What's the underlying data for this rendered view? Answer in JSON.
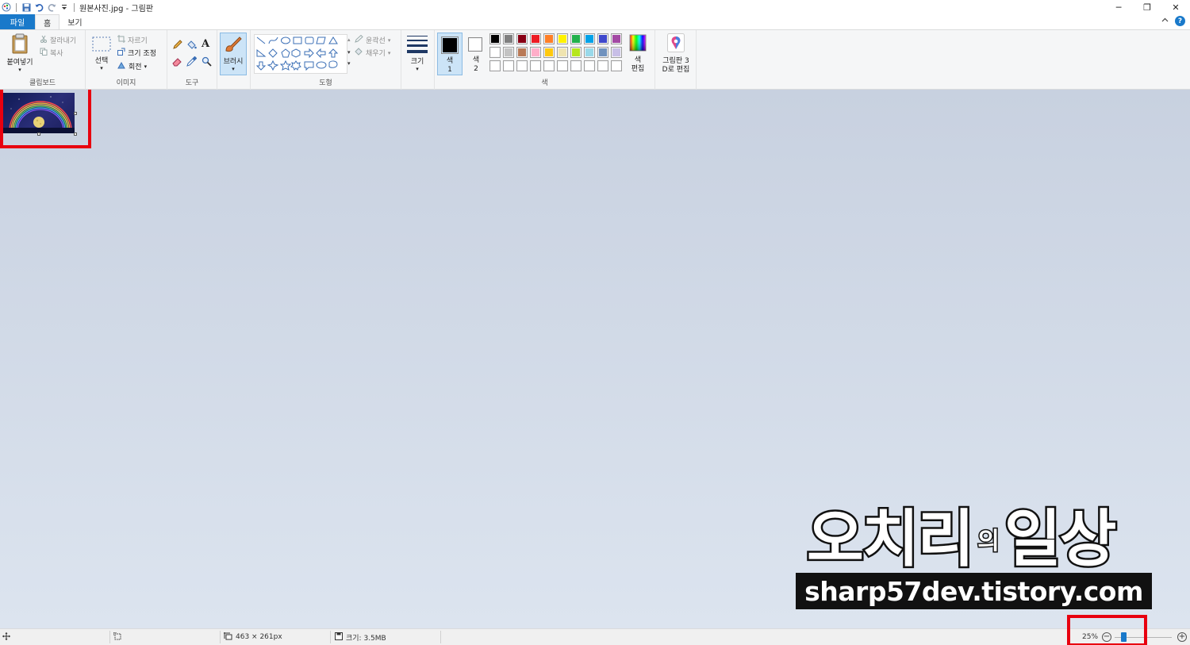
{
  "window": {
    "title": "원본사진.jpg - 그림판",
    "controls": {
      "minimize": "─",
      "restore": "❐",
      "close": "✕"
    }
  },
  "tabs": [
    {
      "label": "파일"
    },
    {
      "label": "홈"
    },
    {
      "label": "보기"
    }
  ],
  "help_label": "?",
  "ribbon": {
    "clipboard": {
      "label": "클립보드",
      "paste": "붙여넣기",
      "cut": "잘라내기",
      "copy": "복사"
    },
    "image": {
      "label": "이미지",
      "select": "선택",
      "crop": "자르기",
      "resize": "크기 조정",
      "rotate": "회전"
    },
    "tools": {
      "label": "도구",
      "text_tool": "A"
    },
    "brushes": {
      "label": "브러시"
    },
    "shapes": {
      "label": "도형",
      "outline": "윤곽선",
      "fill": "채우기"
    },
    "size": {
      "label": "크기"
    },
    "colors": {
      "label": "색",
      "color1_line1": "색",
      "color1_line2": "1",
      "color2_line1": "색",
      "color2_line2": "2",
      "edit_line1": "색",
      "edit_line2": "편집",
      "paint3d_line1": "그림판 3",
      "paint3d_line2": "D로 편집",
      "color1": "#000000",
      "color2": "#ffffff",
      "palette_row1": [
        "#000000",
        "#7f7f7f",
        "#880015",
        "#ed1c24",
        "#ff7f27",
        "#fff200",
        "#22b14c",
        "#00a2e8",
        "#3f48cc",
        "#a349a4"
      ],
      "palette_row2": [
        "#ffffff",
        "#c3c3c3",
        "#b97a57",
        "#ffaec9",
        "#ffc90e",
        "#efe4b0",
        "#b5e61d",
        "#99d9ea",
        "#7092be",
        "#c8bfe7"
      ],
      "palette_row3": [
        "#ffffff",
        "#ffffff",
        "#ffffff",
        "#ffffff",
        "#ffffff",
        "#ffffff",
        "#ffffff",
        "#ffffff",
        "#ffffff",
        "#ffffff"
      ]
    }
  },
  "watermark": {
    "title_part1": "오치리",
    "title_part2": "의",
    "title_part3": "일상",
    "url": "sharp57dev.tistory.com"
  },
  "statusbar": {
    "dimensions": "463 × 261px",
    "file_size": "크기: 3.5MB",
    "zoom": "25%",
    "zoom_out": "−",
    "zoom_in": "+",
    "zoom_level": 0.25
  }
}
